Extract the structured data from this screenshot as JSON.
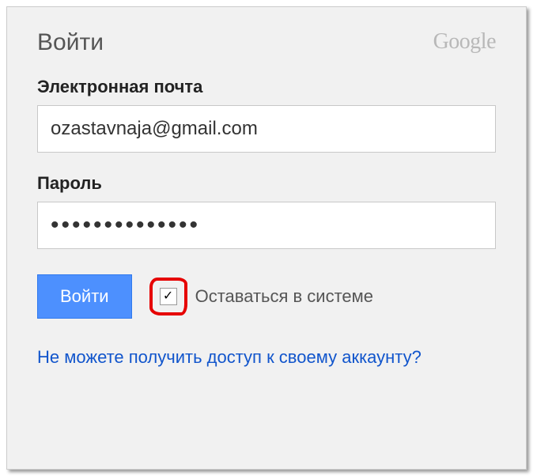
{
  "header": {
    "title": "Войти",
    "brand": "Google"
  },
  "form": {
    "email_label": "Электронная почта",
    "email_value": "ozastavnaja@gmail.com",
    "password_label": "Пароль",
    "password_value": "••••••••••••••",
    "submit_label": "Войти",
    "stay_signed_in_label": "Оставаться в системе",
    "checkbox_mark": "✓"
  },
  "links": {
    "recovery": "Не можете получить доступ к своему аккаунту?"
  }
}
